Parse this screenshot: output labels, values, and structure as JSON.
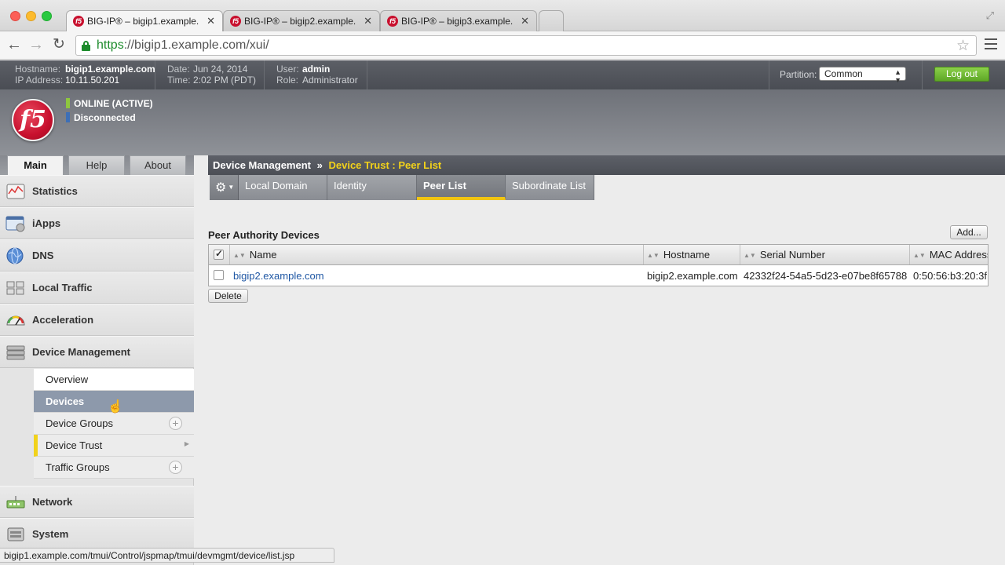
{
  "browser": {
    "tabs": [
      {
        "title": "BIG-IP® – bigip1.example."
      },
      {
        "title": "BIG-IP® – bigip2.example."
      },
      {
        "title": "BIG-IP® – bigip3.example."
      }
    ],
    "url_scheme": "https",
    "url_rest": "://bigip1.example.com/xui/",
    "status_url": "bigip1.example.com/tmui/Control/jspmap/tmui/devmgmt/device/list.jsp"
  },
  "header": {
    "hostname_label": "Hostname:",
    "hostname": "bigip1.example.com",
    "ip_label": "IP Address:",
    "ip": "10.11.50.201",
    "date_label": "Date:",
    "date": "Jun 24, 2014",
    "time_label": "Time:",
    "time": "2:02 PM (PDT)",
    "user_label": "User:",
    "user": "admin",
    "role_label": "Role:",
    "role": "Administrator",
    "partition_label": "Partition:",
    "partition": "Common",
    "logout": "Log out",
    "logo_text": "f5",
    "status_online": "ONLINE (ACTIVE)",
    "status_sync": "Disconnected",
    "colors": {
      "online": "#8ec63f",
      "sync": "#3d6fb6",
      "accent": "#f2d21a"
    }
  },
  "left_tabs": [
    "Main",
    "Help",
    "About"
  ],
  "sidebar": {
    "top_items": [
      {
        "label": "Statistics",
        "icon": "statistics-icon"
      },
      {
        "label": "iApps",
        "icon": "iapps-icon"
      },
      {
        "label": "DNS",
        "icon": "dns-globe-icon"
      },
      {
        "label": "Local Traffic",
        "icon": "local-traffic-icon"
      },
      {
        "label": "Acceleration",
        "icon": "acceleration-gauge-icon"
      },
      {
        "label": "Device Management",
        "icon": "device-management-icon"
      }
    ],
    "sub_items": [
      "Overview",
      "Devices",
      "Device Groups",
      "Device Trust",
      "Traffic Groups"
    ],
    "bottom_items": [
      {
        "label": "Network",
        "icon": "network-icon"
      },
      {
        "label": "System",
        "icon": "system-icon"
      }
    ]
  },
  "breadcrumb": {
    "section": "Device Management",
    "separator": "»",
    "current": "Device Trust : Peer List"
  },
  "subtabs": [
    "Local Domain",
    "Identity",
    "Peer List",
    "Subordinate List"
  ],
  "peer_table": {
    "title": "Peer Authority Devices",
    "add_label": "Add...",
    "delete_label": "Delete",
    "columns": [
      "Name",
      "Hostname",
      "Serial Number",
      "MAC Address"
    ],
    "rows": [
      {
        "name": "bigip2.example.com",
        "hostname": "bigip2.example.com",
        "serial": "42332f24-54a5-5d23-e07be8f65788",
        "mac": "0:50:56:b3:20:3f"
      }
    ]
  }
}
